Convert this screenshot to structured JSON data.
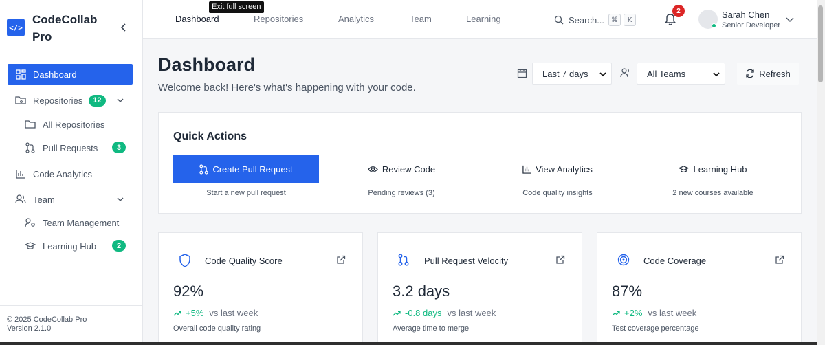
{
  "brand": {
    "name": "CodeCollab Pro",
    "logo": "</>"
  },
  "sidebar": {
    "items": [
      {
        "label": "Dashboard",
        "icon": "grid-icon"
      },
      {
        "label": "Repositories",
        "icon": "folder-git-icon",
        "badge": "12"
      },
      {
        "label": "All Repositories",
        "icon": "folder-icon"
      },
      {
        "label": "Pull Requests",
        "icon": "git-pull-request-icon",
        "badge": "3"
      },
      {
        "label": "Code Analytics",
        "icon": "bar-chart-icon"
      },
      {
        "label": "Team",
        "icon": "users-icon"
      },
      {
        "label": "Team Management",
        "icon": "user-cog-icon"
      },
      {
        "label": "Learning Hub",
        "icon": "graduation-cap-icon",
        "badge": "2"
      }
    ],
    "footer": {
      "copyright": "© 2025 CodeCollab Pro",
      "version": "Version 2.1.0"
    }
  },
  "topbar": {
    "tabs": [
      "Dashboard",
      "Repositories",
      "Analytics",
      "Team",
      "Learning"
    ],
    "tooltip": "Exit full screen",
    "search": {
      "label": "Search...",
      "kbd_cmd": "⌘",
      "kbd_key": "K"
    },
    "notifications": "2",
    "user": {
      "name": "Sarah Chen",
      "role": "Senior Developer"
    }
  },
  "header": {
    "title": "Dashboard",
    "subtitle": "Welcome back! Here's what's happening with your code.",
    "date_range": "Last 7 days",
    "team_filter": "All Teams",
    "refresh_label": "Refresh"
  },
  "quick_actions": {
    "title": "Quick Actions",
    "actions": [
      {
        "label": "Create Pull Request",
        "desc": "Start a new pull request",
        "icon": "git-pull-request-icon"
      },
      {
        "label": "Review Code",
        "desc": "Pending reviews (3)",
        "icon": "eye-icon"
      },
      {
        "label": "View Analytics",
        "desc": "Code quality insights",
        "icon": "bar-chart-icon"
      },
      {
        "label": "Learning Hub",
        "desc": "2 new courses available",
        "icon": "graduation-cap-icon"
      }
    ]
  },
  "metrics": [
    {
      "title": "Code Quality Score",
      "value": "92%",
      "delta": "+5%",
      "vs": "vs last week",
      "desc": "Overall code quality rating",
      "icon": "shield-icon"
    },
    {
      "title": "Pull Request Velocity",
      "value": "3.2 days",
      "delta": "-0.8 days",
      "vs": "vs last week",
      "desc": "Average time to merge",
      "icon": "git-pull-request-icon"
    },
    {
      "title": "Code Coverage",
      "value": "87%",
      "delta": "+2%",
      "vs": "vs last week",
      "desc": "Test coverage percentage",
      "icon": "target-icon"
    }
  ],
  "colors": {
    "accent": "#2563eb",
    "success": "#10b981",
    "danger": "#dc2626"
  }
}
